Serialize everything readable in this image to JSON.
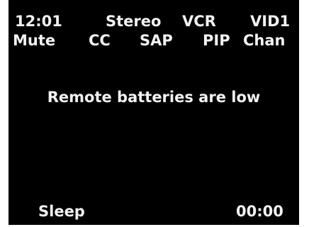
{
  "status_bar": {
    "time": "12:01",
    "audio_mode": "Stereo",
    "source": "VCR",
    "input": "VID1"
  },
  "function_bar": {
    "mute": "Mute",
    "cc": "CC",
    "sap": "SAP",
    "pip": "PIP",
    "chan": "Chan"
  },
  "message": {
    "text": "Remote batteries are low"
  },
  "footer": {
    "sleep_label": "Sleep",
    "sleep_timer": "00:00"
  },
  "colors": {
    "screen_background": "#000000",
    "text": "#f2f2f2",
    "page_background": "#ffffff"
  }
}
